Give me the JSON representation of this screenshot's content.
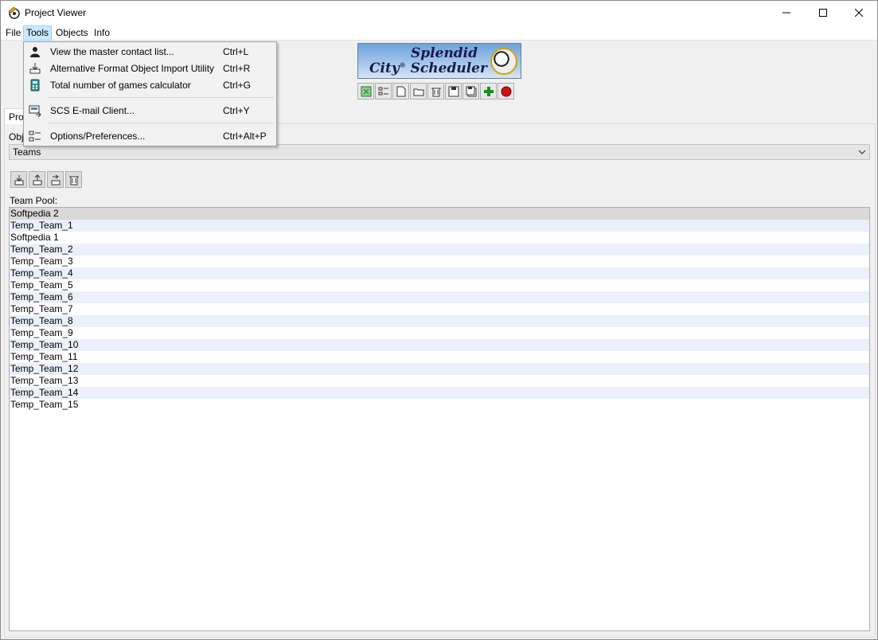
{
  "window": {
    "title": "Project Viewer"
  },
  "menubar": {
    "items": [
      "File",
      "Tools",
      "Objects",
      "Info"
    ]
  },
  "logo": {
    "line1": "Splendid",
    "line2": "City",
    "line2b": "Scheduler",
    "reg": "®"
  },
  "tab": {
    "label": "Proj"
  },
  "objects": {
    "label": "Obj",
    "selected": "Teams"
  },
  "team_pool": {
    "label": "Team Pool:",
    "teams": [
      "Softpedia 2",
      "Temp_Team_1",
      "Softpedia 1",
      "Temp_Team_2",
      "Temp_Team_3",
      "Temp_Team_4",
      "Temp_Team_5",
      "Temp_Team_6",
      "Temp_Team_7",
      "Temp_Team_8",
      "Temp_Team_9",
      "Temp_Team_10",
      "Temp_Team_11",
      "Temp_Team_12",
      "Temp_Team_13",
      "Temp_Team_14",
      "Temp_Team_15"
    ]
  },
  "tools_menu": {
    "items": [
      {
        "label": "View the master contact list...",
        "shortcut": "Ctrl+L",
        "icon": "contact-person-icon"
      },
      {
        "label": "Alternative Format Object Import Utility",
        "shortcut": "Ctrl+R",
        "icon": "import-icon"
      },
      {
        "label": "Total number of games calculator",
        "shortcut": "Ctrl+G",
        "icon": "calculator-icon"
      },
      {
        "label": "SCS E-mail Client...",
        "shortcut": "Ctrl+Y",
        "icon": "email-icon"
      },
      {
        "label": "Options/Preferences...",
        "shortcut": "Ctrl+Alt+P",
        "icon": "options-icon"
      }
    ]
  },
  "colors": {
    "accent_menu": "#cce8ff",
    "row_alt": "#ebf0fa",
    "row_selected": "#d9d9d9"
  }
}
